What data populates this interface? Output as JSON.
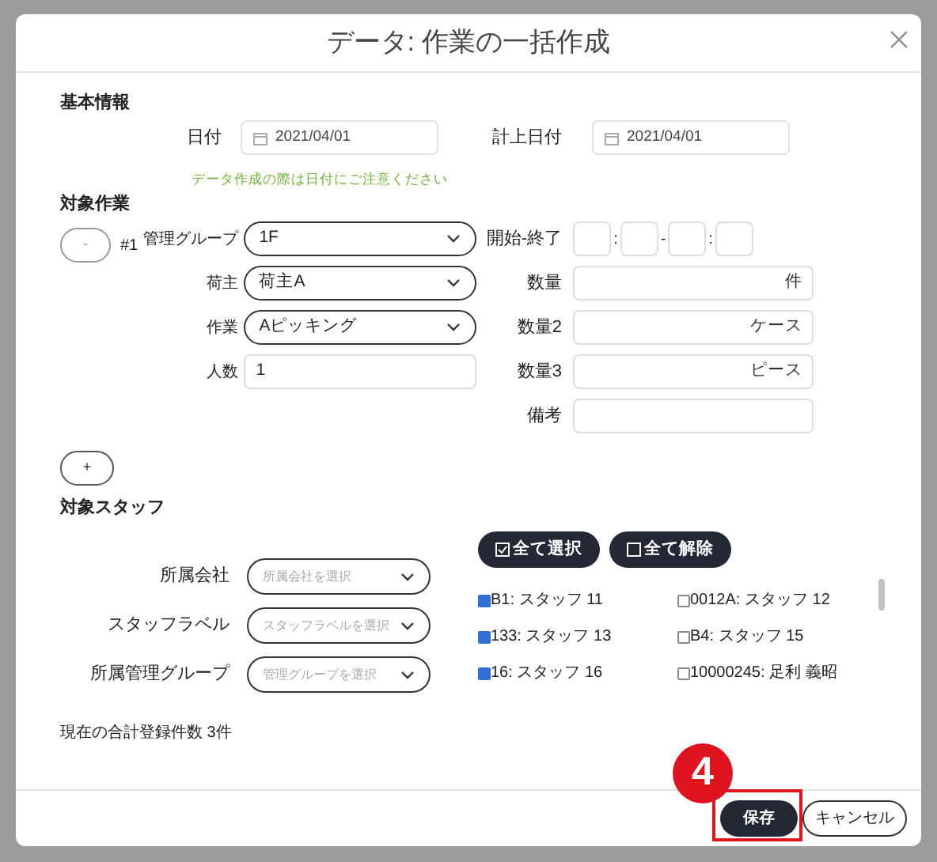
{
  "dialog": {
    "title": "データ: 作業の一括作成"
  },
  "basic": {
    "heading": "基本情報",
    "fields": [
      {
        "label": "日付",
        "value": "2021/04/01"
      },
      {
        "label": "計上日付",
        "value": "2021/04/01"
      }
    ],
    "note": "データ作成の際は日付にご注意ください"
  },
  "tasks": {
    "heading": "対象作業",
    "remove_button": "-",
    "add_button": "+",
    "entries": [
      {
        "number": "#1",
        "rows": [
          {
            "left": {
              "kind": "select",
              "label": "管理グループ",
              "value": "1F"
            },
            "right": {
              "kind": "time",
              "label": "開始-終了",
              "separators": [
                ":",
                "-",
                ":"
              ]
            }
          },
          {
            "left": {
              "kind": "select",
              "label": "荷主",
              "value": "荷主A"
            },
            "right": {
              "kind": "unit",
              "label": "数量",
              "unit": "件"
            }
          },
          {
            "left": {
              "kind": "select",
              "label": "作業",
              "value": "Aピッキング"
            },
            "right": {
              "kind": "unit",
              "label": "数量2",
              "unit": "ケース"
            }
          },
          {
            "left": {
              "kind": "text",
              "label": "人数",
              "value": "1"
            },
            "right": {
              "kind": "unit",
              "label": "数量3",
              "unit": "ピース"
            }
          },
          {
            "right": {
              "kind": "text",
              "label": "備考"
            }
          }
        ]
      }
    ]
  },
  "staff": {
    "heading": "対象スタッフ",
    "filters": [
      {
        "label": "所属会社",
        "placeholder": "所属会社を選択"
      },
      {
        "label": "スタッフラベル",
        "placeholder": "スタッフラベルを選択"
      },
      {
        "label": "所属管理グループ",
        "placeholder": "管理グループを選択"
      }
    ],
    "select_all": "全て選択",
    "clear_all": "全て解除",
    "members": [
      {
        "label": "B1: スタッフ 11",
        "checked": true
      },
      {
        "label": "0012A: スタッフ 12",
        "checked": false
      },
      {
        "label": "133: スタッフ 13",
        "checked": true
      },
      {
        "label": "B4: スタッフ 15",
        "checked": false
      },
      {
        "label": "16: スタッフ 16",
        "checked": true
      },
      {
        "label": "10000245: 足利 義昭",
        "checked": false
      }
    ],
    "total": "現在の合計登録件数 3件"
  },
  "footer": {
    "buttons": [
      {
        "label": "保存",
        "kind": "primary"
      },
      {
        "label": "キャンセル",
        "kind": "secondary"
      }
    ]
  },
  "annotation": {
    "label": "4"
  }
}
